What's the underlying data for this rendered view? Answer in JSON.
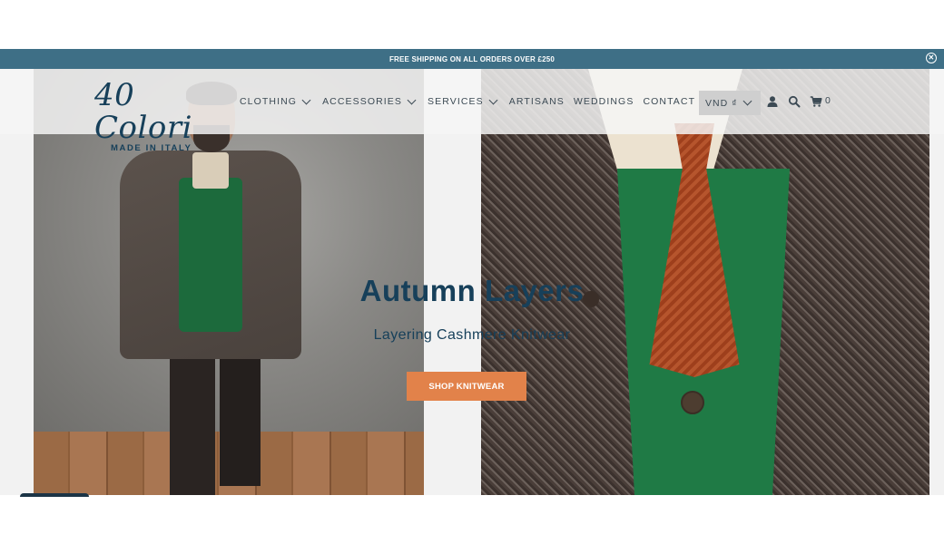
{
  "announcement": {
    "text": "FREE SHIPPING ON ALL ORDERS OVER £250",
    "close_icon": "close-circle-icon",
    "bg_color": "#3e6f86"
  },
  "header": {
    "logo": {
      "script": "40 Colori",
      "tagline": "MADE IN ITALY"
    },
    "nav": [
      {
        "label": "CLOTHING",
        "dropdown": true
      },
      {
        "label": "ACCESSORIES",
        "dropdown": true
      },
      {
        "label": "SERVICES",
        "dropdown": true
      },
      {
        "label": "ARTISANS",
        "dropdown": false
      },
      {
        "label": "WEDDINGS",
        "dropdown": false
      },
      {
        "label": "CONTACT",
        "dropdown": false
      }
    ],
    "currency": {
      "selected": "VND ₫"
    },
    "icons": [
      "user-icon",
      "search-icon",
      "cart-icon"
    ],
    "cart_count": "0"
  },
  "hero": {
    "title": "Autumn Layers",
    "subtitle": "Layering Cashmere Knitwear",
    "cta_label": "SHOP KNITWEAR",
    "cta_color": "#e2824a",
    "text_color": "#17405a"
  }
}
